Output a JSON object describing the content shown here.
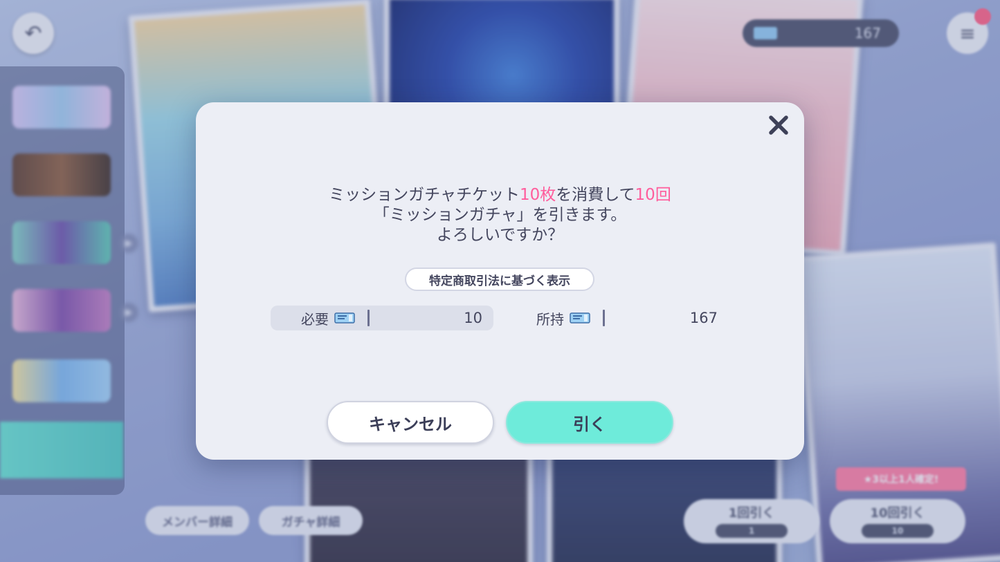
{
  "background": {
    "ticket_count": "167",
    "bottom_pills": [
      "メンバー詳細",
      "ガチャ詳細"
    ],
    "pull_one_label": "1回引く",
    "pull_one_cost": "1",
    "pull_ten_label": "10回引く",
    "pull_ten_cost": "10",
    "guarantee_tag": "★3以上1人確定!"
  },
  "dialog": {
    "message": {
      "line1_prefix": "ミッションガチャチケット",
      "line1_count": "10枚",
      "line1_middle": "を消費して",
      "line1_times": "10回",
      "line2": "「ミッションガチャ」を引きます。",
      "line3": "よろしいですか？"
    },
    "legal_notice_button": "特定商取引法に基づく表示",
    "required": {
      "label": "必要",
      "value": "10"
    },
    "owned": {
      "label": "所持",
      "value": "167"
    },
    "cancel_label": "キャンセル",
    "draw_label": "引く",
    "colors": {
      "accent_pink": "#ff5d9c",
      "draw_button": "#6eebda",
      "dialog_bg": "#eceef5"
    }
  }
}
